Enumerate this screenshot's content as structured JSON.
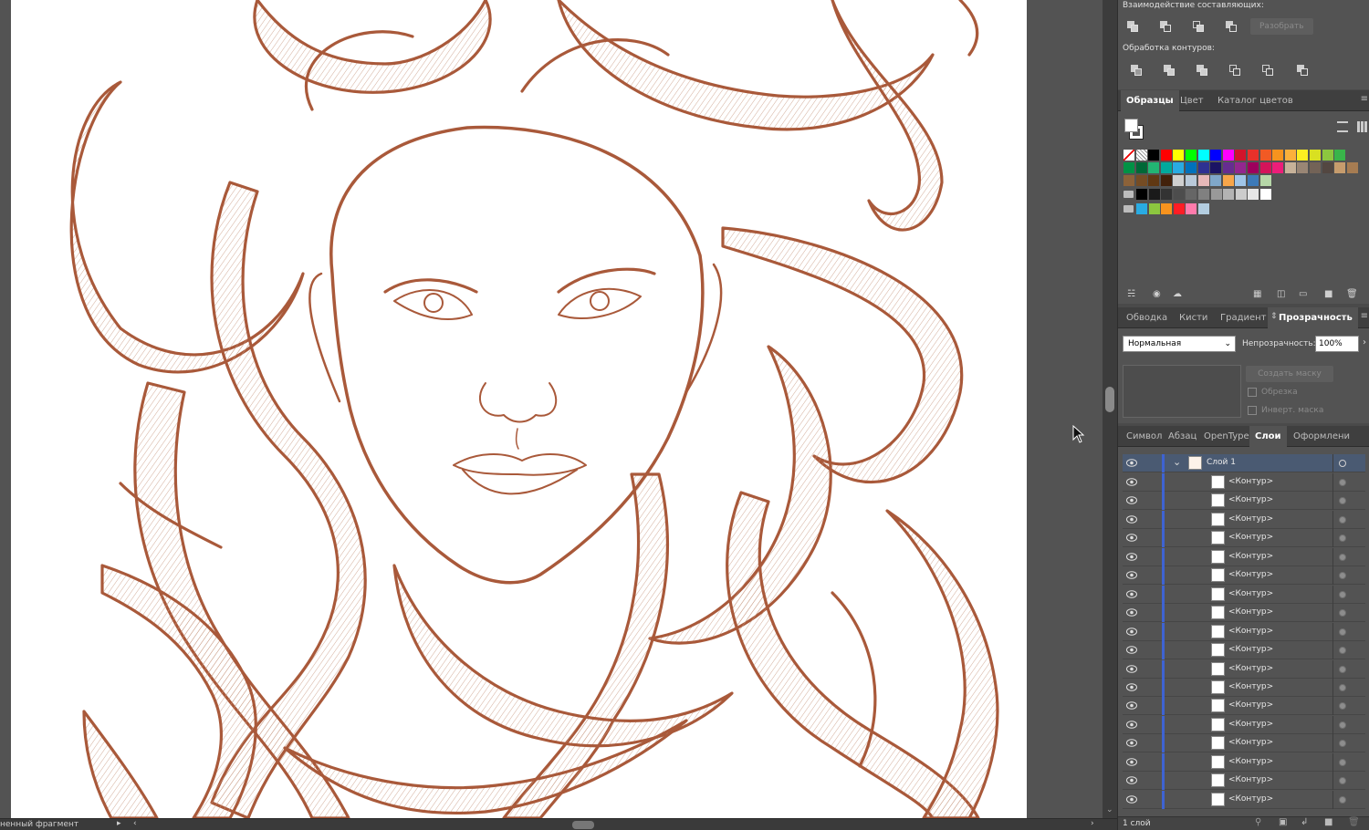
{
  "status_bar": {
    "text": "ненный фрагмент"
  },
  "pathfinder": {
    "shape_modes_label": "Взаимодействие составляющих:",
    "expand_button": "Разобрать",
    "pathfinders_label": "Обработка контуров:"
  },
  "swatches_panel": {
    "tabs": [
      "Образцы",
      "Цвет",
      "Каталог цветов"
    ],
    "active_tab": "Образцы",
    "rows": [
      [
        "#ffffff",
        "#ffffff",
        "#000000",
        "#ff0000",
        "#ffff00",
        "#00ff00",
        "#00ffff",
        "#0000ff",
        "#ff00ff",
        "#d2142b",
        "#e8312a",
        "#f15a24",
        "#f7931e",
        "#fbb03b",
        "#fcee21",
        "#d9e021",
        "#8cc63f",
        "#39b54a"
      ],
      [
        "#009245",
        "#006837",
        "#22b573",
        "#00a99d",
        "#29abe2",
        "#0071bc",
        "#2e3192",
        "#1b1464",
        "#662d91",
        "#93278f",
        "#9e005d",
        "#d4145a",
        "#ed1e79",
        "#c7b299",
        "#998675",
        "#736357",
        "#534741",
        "#c69c6d",
        "#a67c52"
      ],
      [
        "#8c6239",
        "#754c24",
        "#603813",
        "#42210b",
        "#d0d0d0",
        "#b9c9d9",
        "#e6b8b8",
        "#7fa7c9",
        "#f7a64a",
        "#9fc5e8",
        "#3d7ab8",
        "#b6d7a8"
      ],
      [
        "#000000",
        "#1a1a1a",
        "#333333",
        "#4d4d4d",
        "#666666",
        "#808080",
        "#999999",
        "#b3b3b3",
        "#cccccc",
        "#e6e6e6",
        "#ffffff"
      ],
      [
        "#29abe2",
        "#8cc63f",
        "#f7931e",
        "#ff1d25",
        "#ff7bac",
        "#b3cde0"
      ]
    ]
  },
  "appearance_tabs": {
    "tabs": [
      "Обводка",
      "Кисти",
      "Градиент",
      "Прозрачность"
    ],
    "active_tab": "Прозрачность",
    "blend_mode": "Нормальная",
    "opacity_label": "Непрозрачность:",
    "opacity_value": "100%",
    "make_mask_button": "Создать маску",
    "clip_label": "Обрезка",
    "invert_label": "Инверт. маска"
  },
  "layers_panel": {
    "tabs": [
      "Символ",
      "Абзац",
      "OpenType",
      "Слои",
      "Оформлени"
    ],
    "active_tab": "Слои",
    "layer_name": "Слой 1",
    "sublayers": [
      "<Контур>",
      "<Контур>",
      "<Контур>",
      "<Контур>",
      "<Контур>",
      "<Контур>",
      "<Контур>",
      "<Контур>",
      "<Контур>",
      "<Контур>",
      "<Контур>",
      "<Контур>",
      "<Контур>",
      "<Контур>",
      "<Контур>",
      "<Контур>",
      "<Контур>",
      "<Контур>"
    ],
    "footer_text": "1 слой"
  },
  "colors": {
    "artwork_stroke": "#a9593a",
    "panel_bg": "#535353",
    "layer_highlight": "#3e63d2"
  }
}
